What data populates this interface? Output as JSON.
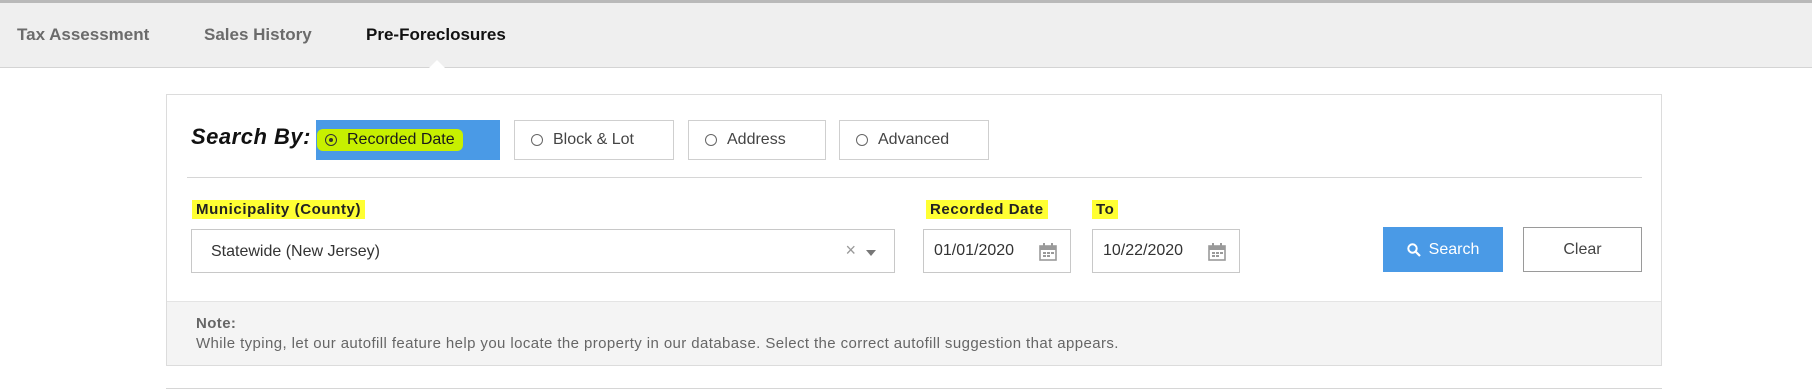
{
  "tabs": [
    {
      "label": "Tax Assessment",
      "active": false
    },
    {
      "label": "Sales History",
      "active": false
    },
    {
      "label": "Pre-Foreclosures",
      "active": true
    }
  ],
  "search_by": {
    "label": "Search By:",
    "options": [
      {
        "label": "Recorded Date",
        "selected": true
      },
      {
        "label": "Block & Lot",
        "selected": false
      },
      {
        "label": "Address",
        "selected": false
      },
      {
        "label": "Advanced",
        "selected": false
      }
    ]
  },
  "fields": {
    "municipality_label": "Municipality (County)",
    "municipality_value": "Statewide (New Jersey)",
    "recorded_date_label": "Recorded Date",
    "recorded_date_value": "01/01/2020",
    "to_label": "To",
    "to_value": "10/22/2020"
  },
  "buttons": {
    "search": "Search",
    "clear": "Clear"
  },
  "note": {
    "title": "Note:",
    "text": "While typing, let our autofill feature help you locate the property in our database. Select the correct autofill suggestion that appears."
  },
  "colors": {
    "accent": "#4a9ae6",
    "highlight_yellow": "#ffff33",
    "highlight_green": "#c7f000"
  }
}
